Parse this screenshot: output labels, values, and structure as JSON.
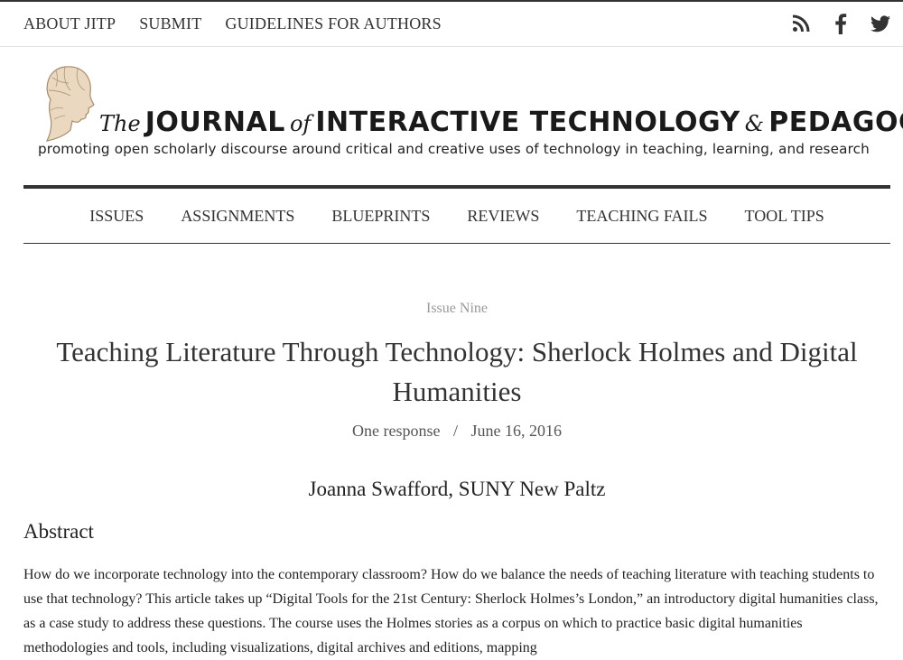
{
  "topnav": {
    "items": [
      {
        "label": "ABOUT JITP"
      },
      {
        "label": "SUBMIT"
      },
      {
        "label": "GUIDELINES FOR AUTHORS"
      }
    ]
  },
  "social": {
    "icons": [
      "rss-icon",
      "facebook-icon",
      "twitter-icon"
    ]
  },
  "masthead": {
    "the": "The",
    "journal": "JOURNAL",
    "of": "of",
    "interactive": "INTERACTIVE TECHNOLOGY",
    "amp": "&",
    "pedagogy": "PEDAGOGY",
    "tagline": "promoting open scholarly discourse around critical and creative uses of technology in teaching, learning, and research"
  },
  "mainnav": {
    "items": [
      {
        "label": "ISSUES"
      },
      {
        "label": "ASSIGNMENTS"
      },
      {
        "label": "BLUEPRINTS"
      },
      {
        "label": "REVIEWS"
      },
      {
        "label": "TEACHING FAILS"
      },
      {
        "label": "TOOL TIPS"
      }
    ]
  },
  "article": {
    "issue": "Issue Nine",
    "title": "Teaching Literature Through Technology: Sherlock Holmes and Digital Humanities",
    "responses": "One response",
    "separator": "/",
    "date": "June 16, 2016",
    "author": "Joanna Swafford, SUNY New Paltz",
    "abstract_heading": "Abstract",
    "abstract_text": "How do we incorporate technology into the contemporary classroom? How do we balance the needs of teaching literature with teaching students to use that technology? This article takes up “Digital Tools for the 21st Century: Sherlock Holmes’s London,” an introductory digital humanities class, as a case study to address these questions. The course uses the Holmes stories as a corpus on which to practice basic digital humanities methodologies and tools, including visualizations, digital archives and editions, mapping"
  },
  "colors": {
    "text": "#333333",
    "muted": "#999999",
    "rule": "#333333"
  }
}
